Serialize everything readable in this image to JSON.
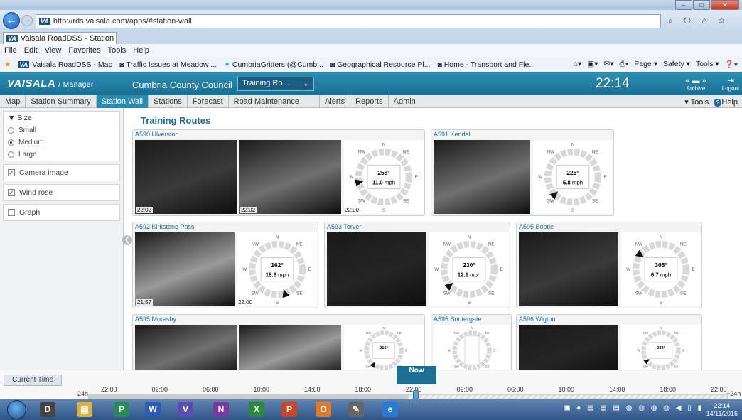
{
  "browser": {
    "url": "http://rds.vaisala.com/apps/#station-wall",
    "tab_title": "Vaisala RoadDSS - Station ...",
    "menu": [
      "File",
      "Edit",
      "View",
      "Favorites",
      "Tools",
      "Help"
    ],
    "favorites": [
      "Vaisala RoadDSS - Map",
      "Traffic Issues at Meadow ...",
      "CumbriaGritters (@Cumb...",
      "Geographical Resource Pl...",
      "Home - Transport and Fle..."
    ],
    "command_bar": [
      "Page ▾",
      "Safety ▾",
      "Tools ▾"
    ]
  },
  "app": {
    "logo": "VAISALA",
    "role": "/ Manager",
    "council": "Cumbria County Council",
    "route_select": "Training Ro...",
    "clock": "22:14",
    "archive": "Archive",
    "logout": "Logout",
    "nav": [
      "Map",
      "Station Summary",
      "Station Wall",
      "Stations",
      "Forecast",
      "Road Maintenance",
      "Alerts",
      "Reports",
      "Admin"
    ],
    "active_nav": "Station Wall",
    "nav_right_tools": "▾ Tools",
    "nav_right_help": "Help"
  },
  "sidebar": {
    "size_heading": "▼ Size",
    "size_options": [
      "Small",
      "Medium",
      "Large"
    ],
    "size_selected": "Medium",
    "toggles": [
      {
        "label": "Camera image",
        "checked": true
      },
      {
        "label": "Wind rose",
        "checked": true
      },
      {
        "label": "Graph",
        "checked": false
      }
    ]
  },
  "main": {
    "heading": "Training Routes",
    "stations": [
      {
        "name": "A590 Ulverston",
        "cam_times": [
          "22:02",
          "22:02"
        ],
        "direction": "258°",
        "speed": "11.0",
        "unit": "mph",
        "wind_time": "22:00"
      },
      {
        "name": "A591 Kendal",
        "cam_times": [],
        "direction": "226°",
        "speed": "5.8",
        "unit": "mph",
        "wind_time": ""
      },
      {
        "name": "A592 Kirkstone Pass",
        "cam_times": [
          "21:57"
        ],
        "direction": "162°",
        "speed": "18.6",
        "unit": "mph",
        "wind_time": "22:00"
      },
      {
        "name": "A593 Torver",
        "cam_times": [],
        "direction": "230°",
        "speed": "12.1",
        "unit": "mph",
        "wind_time": ""
      },
      {
        "name": "A595 Bootle",
        "cam_times": [],
        "direction": "305°",
        "speed": "6.7",
        "unit": "mph",
        "wind_time": ""
      },
      {
        "name": "A595 Moresby",
        "cam_times": [],
        "direction": "216°",
        "speed": "",
        "unit": "",
        "wind_time": ""
      },
      {
        "name": "A595 Soutergate",
        "cam_times": [],
        "direction": "",
        "speed": "",
        "unit": "",
        "wind_time": ""
      },
      {
        "name": "A596 Wigton",
        "cam_times": [],
        "direction": "233°",
        "speed": "",
        "unit": "",
        "wind_time": ""
      }
    ],
    "compass": [
      "N",
      "NE",
      "E",
      "SE",
      "S",
      "SW",
      "W",
      "NW"
    ]
  },
  "timeline": {
    "current_time_button": "Current Time",
    "now_button": "Now",
    "start_label": "-24h",
    "end_label": "+24h",
    "ticks": [
      "22:00",
      "02:00",
      "06:00",
      "10:00",
      "14:00",
      "18:00",
      "22:00",
      "02:00",
      "06:00",
      "10:00",
      "14:00",
      "18:00",
      "22:00"
    ],
    "position_fraction": 0.5
  },
  "taskbar": {
    "time": "22:14",
    "date": "14/11/2016"
  },
  "colors": {
    "accent": "#1b6f95",
    "header": "#2c8fb3"
  }
}
